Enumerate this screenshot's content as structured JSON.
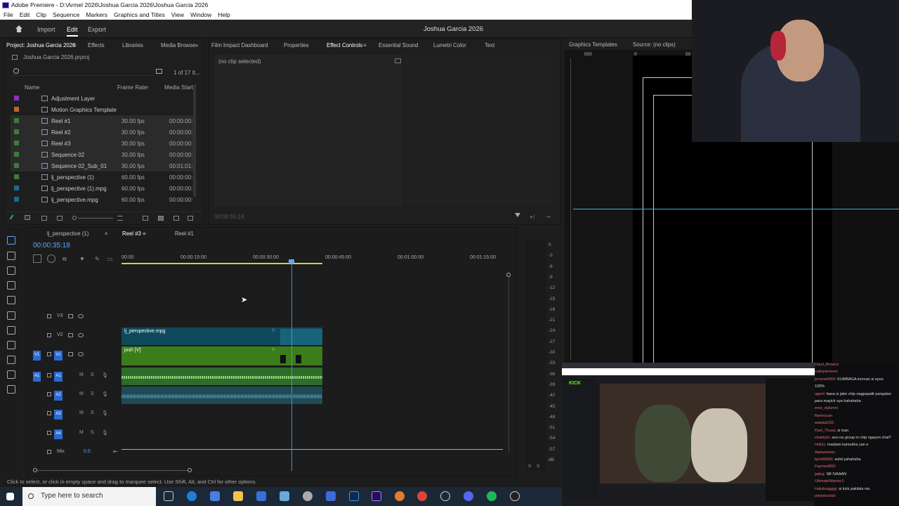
{
  "window": {
    "title": "Adobe Premiere - D:\\Armel 2026\\Joshua Garcia 2026\\Joshua Garcia 2026"
  },
  "menu": [
    "File",
    "Edit",
    "Clip",
    "Sequence",
    "Markers",
    "Graphics and Titles",
    "View",
    "Window",
    "Help"
  ],
  "appbar": {
    "import": "Import",
    "edit": "Edit",
    "export": "Export",
    "project_title": "Joshua Garcia 2026"
  },
  "project": {
    "tabs": [
      "Project: Joshua Garcia 2026",
      "Effects",
      "Libraries",
      "Media Browse"
    ],
    "file": "Joshua Garcia 2026.prproj",
    "count": "1 of 17 It...",
    "columns": {
      "name": "Name",
      "frame_rate": "Frame Rate",
      "media_start": "Media Start"
    },
    "items": [
      {
        "name": "Adjustment Layer",
        "fps": "",
        "start": "",
        "color": "#8b2fbf"
      },
      {
        "name": "Motion Graphics Template",
        "fps": "",
        "start": "",
        "color": "#c0642a"
      },
      {
        "name": "Reel #1",
        "fps": "30.00 fps",
        "start": "00:00:00:",
        "color": "#3f7a3a"
      },
      {
        "name": "Reel #2",
        "fps": "30.00 fps",
        "start": "00:00:00:",
        "color": "#3f7a3a"
      },
      {
        "name": "Reel #3",
        "fps": "30.00 fps",
        "start": "00:00:00:",
        "color": "#3f7a3a"
      },
      {
        "name": "Sequence 02",
        "fps": "30.00 fps",
        "start": "00:00:00:",
        "color": "#3f7a3a"
      },
      {
        "name": "Sequence 02_Sub_01",
        "fps": "30.00 fps",
        "start": "00:01:01:",
        "color": "#3f7a3a"
      },
      {
        "name": "lj_perspective (1)",
        "fps": "60.00 fps",
        "start": "00:00:00:",
        "color": "#3f7a3a"
      },
      {
        "name": "lj_perspective (1).mpg",
        "fps": "60.00 fps",
        "start": "00:00:00:",
        "color": "#1a6b8f"
      },
      {
        "name": "lj_perspective.mpg",
        "fps": "60.00 fps",
        "start": "00:00:00:",
        "color": "#1a6b8f"
      }
    ]
  },
  "effect": {
    "tabs": [
      "Film Impact Dashboard",
      "Properties",
      "Effect Controls",
      "Essential Sound",
      "Lumetri Color",
      "Text"
    ],
    "no_clip": "(no clip selected)",
    "timecode": "00:00:35:18"
  },
  "source": {
    "tabs": [
      "Graphics Templates",
      "Source: (no clips)"
    ],
    "ruler": [
      "500",
      "0",
      "50"
    ]
  },
  "timeline": {
    "tabs": [
      "lj_perspective (1)",
      "Reel #3",
      "Reel #1"
    ],
    "timecode": "00:00:35:18",
    "ruler": [
      "00:00",
      "00:00:15:00",
      "00:00:30:00",
      "00:00:45:00",
      "00:01:00:00",
      "00:01:15:00"
    ],
    "video_tracks": [
      "V3",
      "V2",
      "V1"
    ],
    "audio_tracks": [
      "A1",
      "A2",
      "A3",
      "A4"
    ],
    "src_v": "V1",
    "src_a": "A1",
    "mix_label": "Mix",
    "mix_value": "0.0",
    "m_label": "M",
    "s_label": "S",
    "clip_v2": "lj_perspective.mpg",
    "clip_v1": "josh [V]",
    "fx": "fx"
  },
  "meter": {
    "labels": [
      "0",
      "-3",
      "-6",
      "-9",
      "-12",
      "-15",
      "-18",
      "-21",
      "-24",
      "-27",
      "-30",
      "-33",
      "-36",
      "-39",
      "-42",
      "-45",
      "-48",
      "-51",
      "-54",
      "-57",
      "dB"
    ],
    "solo": "S",
    "solo2": "S"
  },
  "status": "Click to select, or click in empty space and drag to marquee select. Use Shift, Alt, and Ctrl for other options.",
  "taskbar": {
    "search": "Type here to search"
  },
  "chat": [
    {
      "user": "Daryl_Brownz",
      "text": ""
    },
    {
      "user": "cutiepiemooo",
      "text": ""
    },
    {
      "user": "jerome6060:",
      "text": "KUMBAGA innman si ayoo"
    },
    {
      "user": "",
      "text": "100%"
    },
    {
      "user": "agent:",
      "text": "basa si jabo chip nagpapalit pangalan"
    },
    {
      "user": "",
      "text": "para mayick sya hahahaha"
    },
    {
      "user": "eme_dulumni",
      "text": ""
    },
    {
      "user": "flamescan",
      "text": ""
    },
    {
      "user": "watatai155:",
      "text": ""
    },
    {
      "user": "Kael_Thusa:",
      "text": "si ivan"
    },
    {
      "user": "shakkylo:",
      "text": "ano na group ni chip ngayon chat?"
    },
    {
      "user": "Hellzy:",
      "text": "madami kamukha yan e"
    },
    {
      "user": "Aaewannac:",
      "text": ""
    },
    {
      "user": "lgris66660:",
      "text": "solid yahahaha"
    },
    {
      "user": "Faymed900:",
      "text": ""
    },
    {
      "user": "jwjkaj:",
      "text": "SB IVAAAN"
    },
    {
      "user": "UltimateWarrior1:",
      "text": ""
    },
    {
      "user": "Hakdoogggg:",
      "text": "si kick pakilala mo"
    },
    {
      "user": "poloytochist:",
      "text": ""
    }
  ],
  "colors": {
    "accent": "#2a6ad1",
    "clip_blue": "#0e4a5c",
    "clip_green": "#3b7d1a",
    "audio_green": "#2f6b2a",
    "playhead": "#4b8ae0"
  }
}
